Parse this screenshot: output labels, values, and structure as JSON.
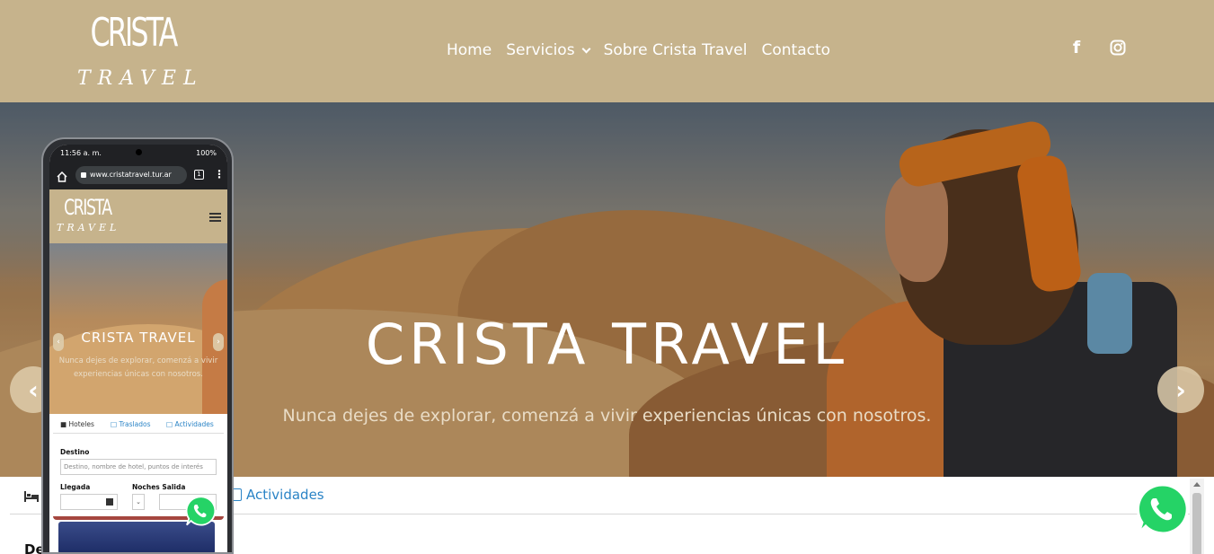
{
  "header": {
    "logo_main": "CRISTA",
    "logo_sub": "TRAVEL",
    "nav": [
      {
        "label": "Home"
      },
      {
        "label": "Servicios",
        "has_dropdown": true
      },
      {
        "label": "Sobre Crista Travel"
      },
      {
        "label": "Contacto"
      }
    ],
    "social": {
      "facebook_icon": "facebook-icon",
      "facebook_glyph": "f",
      "instagram_icon": "instagram-icon"
    },
    "background_color": "#c6b38c"
  },
  "hero": {
    "title": "CRISTA TRAVEL",
    "subtitle": "Nunca dejes de explorar, comenzá a vivir experiencias únicas con nosotros.",
    "prev_arrow": "‹",
    "next_arrow": "›"
  },
  "booking": {
    "hotel_icon": "bed-icon",
    "activities_tab": "Actividades",
    "destination_label": "Desti"
  },
  "phone": {
    "status_time": "11:56 a. m.",
    "status_battery": "100%",
    "url": "www.cristatravel.tur.ar",
    "tabs_count": "1",
    "menu_glyph": "⋮",
    "logo_main": "CRISTA",
    "logo_sub": "TRAVEL",
    "hero_title": "CRISTA TRAVEL",
    "hero_subtitle": "Nunca dejes de explorar, comenzá a vivir experiencias únicas con nosotros.",
    "arrow_left": "‹",
    "arrow_right": "›",
    "tabs": {
      "hoteles": "Hoteles",
      "traslados": "Traslados",
      "actividades": "Actividades"
    },
    "destino_label": "Destino",
    "destino_placeholder": "Destino, nombre de hotel, puntos de interés",
    "llegada_label": "Llegada",
    "noches_label": "Noches Salida",
    "nights_select": "⌄"
  },
  "colors": {
    "brand_sand": "#c6b38c",
    "link_blue": "#2b84c6",
    "whatsapp_green": "#25d366"
  }
}
